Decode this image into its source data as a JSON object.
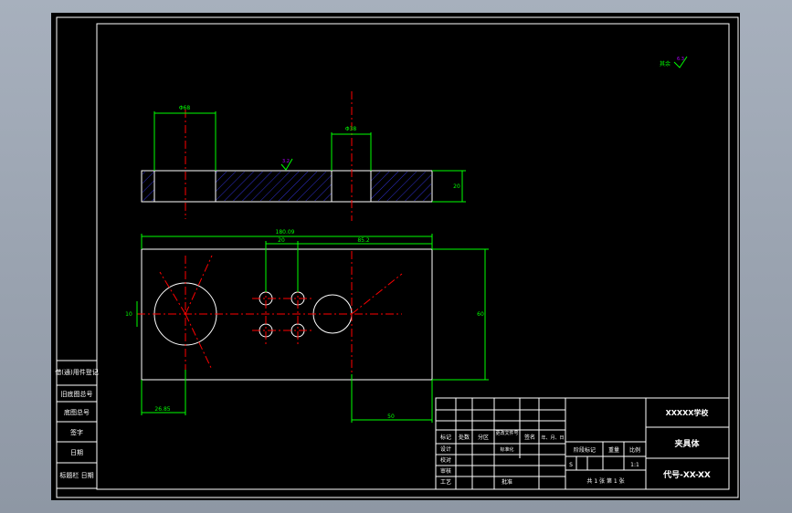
{
  "colors": {
    "background": "#a7b0bd",
    "sheet": "#000000",
    "border": "#ffffff",
    "dimension": "#00ff00",
    "centerline": "#ff0000",
    "hatch": "#3030d0",
    "surface_mark": "#b000ff"
  },
  "drawing": {
    "surface_finish": {
      "label": "其余",
      "value": "6.3"
    },
    "section_roughness": "3.2",
    "dimensions": {
      "hole_left_dia": "Φ68",
      "hole_right_dia": "Φ38",
      "section_thickness": "20",
      "overall_length": "180.09",
      "small_holes_span": "20",
      "holes_to_right": "85.2",
      "left_height": "10",
      "right_height": "60",
      "bottom_left": "26.85",
      "bottom_right": "50"
    }
  },
  "side_block": {
    "rows": [
      "借(通)用件登记",
      "旧底图总号",
      "底图总号",
      "签字",
      "日期",
      "标题栏 日期"
    ]
  },
  "title_block": {
    "school": "XXXXX学校",
    "name": "夹具体",
    "code": "代号-XX-XX",
    "headers": [
      "标记",
      "处数",
      "分区",
      "更改文件号",
      "签名",
      "年、月、日"
    ],
    "roles": [
      "设计",
      "校对",
      "审核",
      "工艺"
    ],
    "standardize": "标准化",
    "approve": "批准",
    "stage_mark": "阶段标记",
    "weight": "重量",
    "scale": "比例",
    "stage_value": "S",
    "scale_value": "1:1",
    "sheets": "共 1 张  第 1 张"
  }
}
